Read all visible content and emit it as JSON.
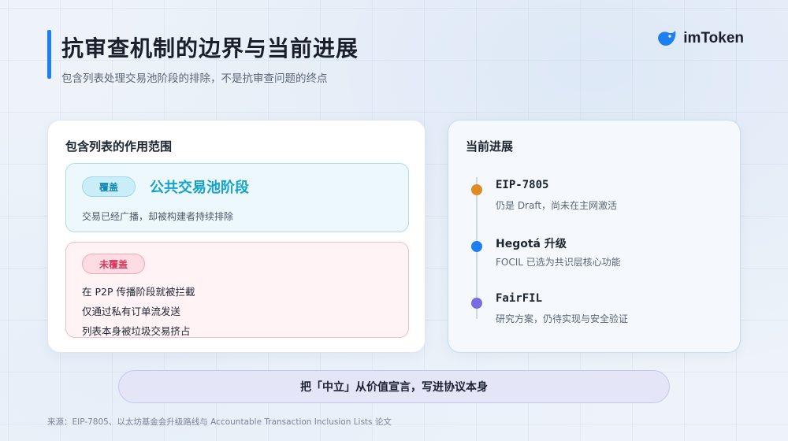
{
  "header": {
    "title": "抗审查机制的边界与当前进展",
    "subtitle": "包含列表处理交易池阶段的排除，不是抗审查问题的终点"
  },
  "logo": {
    "text": "imToken",
    "icon": "imtoken-logo-icon",
    "color": "#1e7ff0"
  },
  "scope_card": {
    "title": "包含列表的作用范围",
    "covered": {
      "badge": "覆盖",
      "heading": "公共交易池阶段",
      "description": "交易已经广播，却被构建者持续排除"
    },
    "uncovered": {
      "badge": "未覆盖",
      "items": [
        "在 P2P 传播阶段就被拦截",
        "仅通过私有订单流发送",
        "列表本身被垃圾交易挤占"
      ]
    }
  },
  "progress_card": {
    "title": "当前进展",
    "items": [
      {
        "title": "EIP-7805",
        "description": "仍是 Draft，尚未在主网激活",
        "color": "#e08a24"
      },
      {
        "title": "Hegotá 升级",
        "description": "FOCIL 已选为共识层核心功能",
        "color": "#1e7ff0"
      },
      {
        "title": "FairFIL",
        "description": "研究方案，仍待实现与安全验证",
        "color": "#7b6be0"
      }
    ]
  },
  "banner": {
    "text": "把「中立」从价值宣言，写进协议本身"
  },
  "footnote": {
    "text": "来源：EIP-7805、以太坊基金会升级路线与 Accountable Transaction Inclusion Lists 论文"
  }
}
